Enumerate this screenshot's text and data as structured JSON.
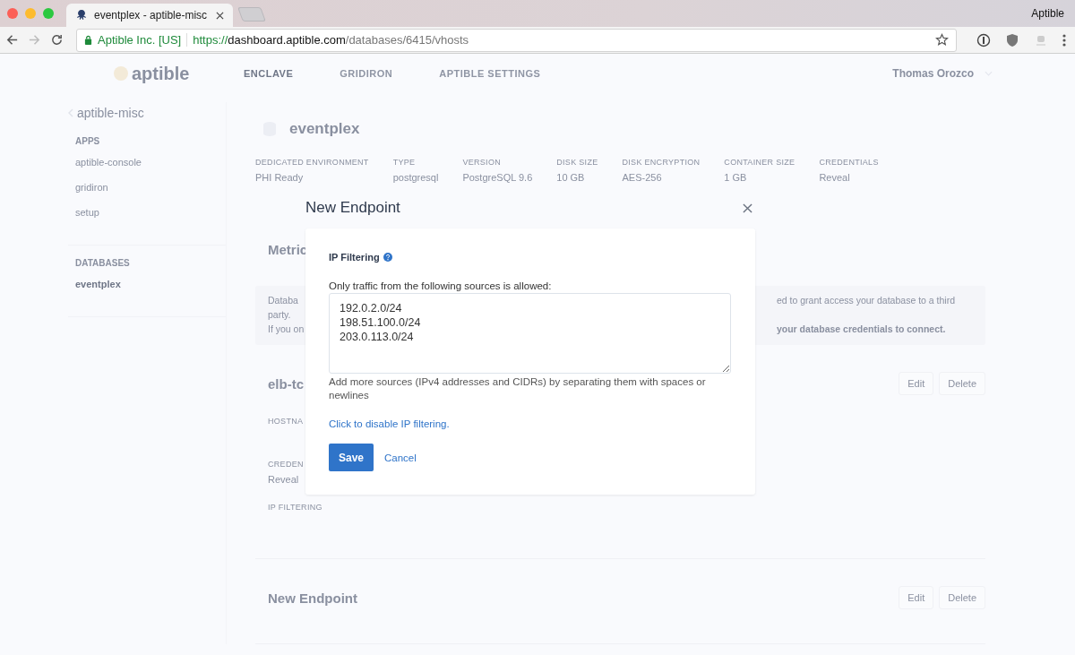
{
  "browser": {
    "tab_title": "eventplex - aptible-misc",
    "app_name": "Aptible",
    "site_identity": "Aptible Inc. [US]",
    "url_scheme": "https://",
    "url_host": "dashboard.aptible.com",
    "url_path": "/databases/6415/vhosts"
  },
  "page": {
    "logo": "aptible",
    "nav": [
      {
        "label": "ENCLAVE",
        "selected": true
      },
      {
        "label": "GRIDIRON",
        "selected": false
      },
      {
        "label": "APTIBLE SETTINGS",
        "selected": false
      }
    ],
    "user": "Thomas Orozco",
    "back_link": "aptible-misc",
    "sidebar": [
      {
        "heading": "APPS",
        "items": [
          {
            "label": "aptible-console",
            "selected": false
          },
          {
            "label": "gridiron",
            "selected": false
          },
          {
            "label": "setup",
            "selected": false
          }
        ]
      },
      {
        "heading": "DATABASES",
        "items": [
          {
            "label": "eventplex",
            "selected": true
          }
        ]
      }
    ],
    "database": {
      "name": "eventplex",
      "stats": [
        {
          "label": "DEDICATED ENVIRONMENT",
          "value": "PHI Ready"
        },
        {
          "label": "TYPE",
          "value": "postgresql"
        },
        {
          "label": "VERSION",
          "value": "PostgreSQL 9.6"
        },
        {
          "label": "DISK SIZE",
          "value": "10 GB"
        },
        {
          "label": "DISK ENCRYPTION",
          "value": "AES-256"
        },
        {
          "label": "CONTAINER SIZE",
          "value": "1 GB"
        },
        {
          "label": "CREDENTIALS",
          "value": "Reveal"
        }
      ]
    },
    "metrics_heading": "Metric",
    "notice": {
      "left": [
        "Databa",
        "party.",
        "If you on"
      ],
      "right": [
        "ed to grant access your database to a third",
        "your database credentials to connect."
      ]
    },
    "endpoints": [
      {
        "name": "elb-tc",
        "buttons": [
          "Edit",
          "Delete"
        ],
        "fields": [
          {
            "label": "HOSTNA"
          },
          {
            "label": "CREDEN",
            "value": "Reveal"
          },
          {
            "label": "IP FILTERING"
          }
        ]
      },
      {
        "name": "New Endpoint",
        "buttons": [
          "Edit",
          "Delete"
        ]
      }
    ]
  },
  "modal": {
    "title": "New Endpoint",
    "section_title": "IP Filtering",
    "prompt": "Only traffic from the following sources is allowed:",
    "sources": "192.0.2.0/24\n198.51.100.0/24\n203.0.113.0/24",
    "hint": "Add more sources (IPv4 addresses and CIDRs) by separating them with spaces or newlines",
    "toggle_link": "Click to disable IP filtering.",
    "buttons": [
      {
        "label": "Save",
        "kind": "primary"
      },
      {
        "label": "Cancel",
        "kind": "link"
      }
    ]
  }
}
